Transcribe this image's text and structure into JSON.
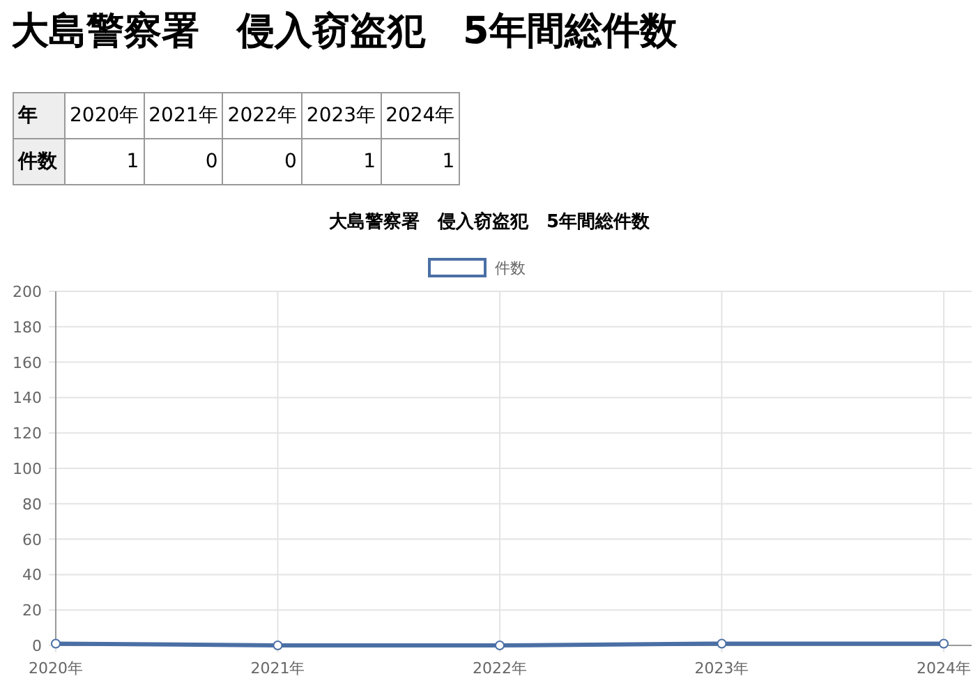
{
  "title": "大島警察署　侵入窃盗犯　5年間総件数",
  "table": {
    "row_headers": [
      "年",
      "件数"
    ],
    "columns": [
      "2020年",
      "2021年",
      "2022年",
      "2023年",
      "2024年"
    ],
    "values": [
      "1",
      "0",
      "0",
      "1",
      "1"
    ]
  },
  "chart": {
    "chart_data": {
      "type": "line",
      "title": "大島警察署　侵入窃盗犯　5年間総件数",
      "categories": [
        "2020年",
        "2021年",
        "2022年",
        "2023年",
        "2024年"
      ],
      "series": [
        {
          "name": "件数",
          "color": "#4a6fa5",
          "marker": true,
          "values": [
            1,
            0,
            0,
            1,
            1
          ]
        }
      ],
      "grid": true,
      "ylim": [
        0,
        200
      ],
      "yticks": [
        0,
        20,
        40,
        60,
        80,
        100,
        120,
        140,
        160,
        180,
        200
      ]
    }
  }
}
